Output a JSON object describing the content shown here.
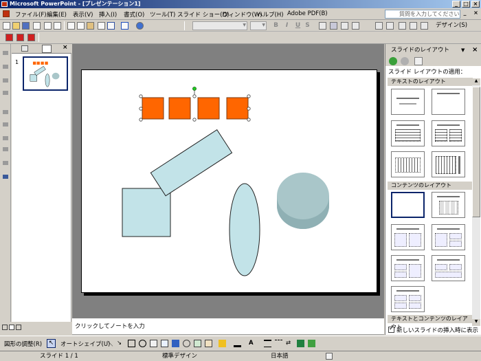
{
  "window": {
    "title": "Microsoft PowerPoint - [プレゼンテーション1]"
  },
  "menu": {
    "items": [
      "ファイル(F)",
      "編集(E)",
      "表示(V)",
      "挿入(I)",
      "書式(O)",
      "ツール(T)",
      "スライド ショー(D)",
      "ウィンドウ(W)",
      "ヘルプ(H)",
      "Adobe PDF(B)"
    ],
    "help_placeholder": "質問を入力してください"
  },
  "toolbar": {
    "design_label": "デザイン(S)"
  },
  "thumbnails": {
    "slide_number": "1"
  },
  "notes": {
    "placeholder": "クリックしてノートを入力"
  },
  "task_pane": {
    "title": "スライドのレイアウト",
    "apply_label": "スライド レイアウトの適用：",
    "sections": [
      "テキストのレイアウト",
      "コンテンツのレイアウト",
      "テキストとコンテンツのレイアウト"
    ],
    "checkbox_label": "新しいスライドの挿入時に表示する"
  },
  "draw_toolbar": {
    "draw_menu": "図形の調整(R)",
    "autoshape_menu": "オートシェイプ(U)"
  },
  "status": {
    "slide": "スライド 1 / 1",
    "design": "標準デザイン",
    "language": "日本語"
  },
  "colors": {
    "orange": "#ff6600",
    "shape_fill": "#c2e3e8",
    "cylinder": "#a9c6c9",
    "title_bar": "#0a246a"
  }
}
